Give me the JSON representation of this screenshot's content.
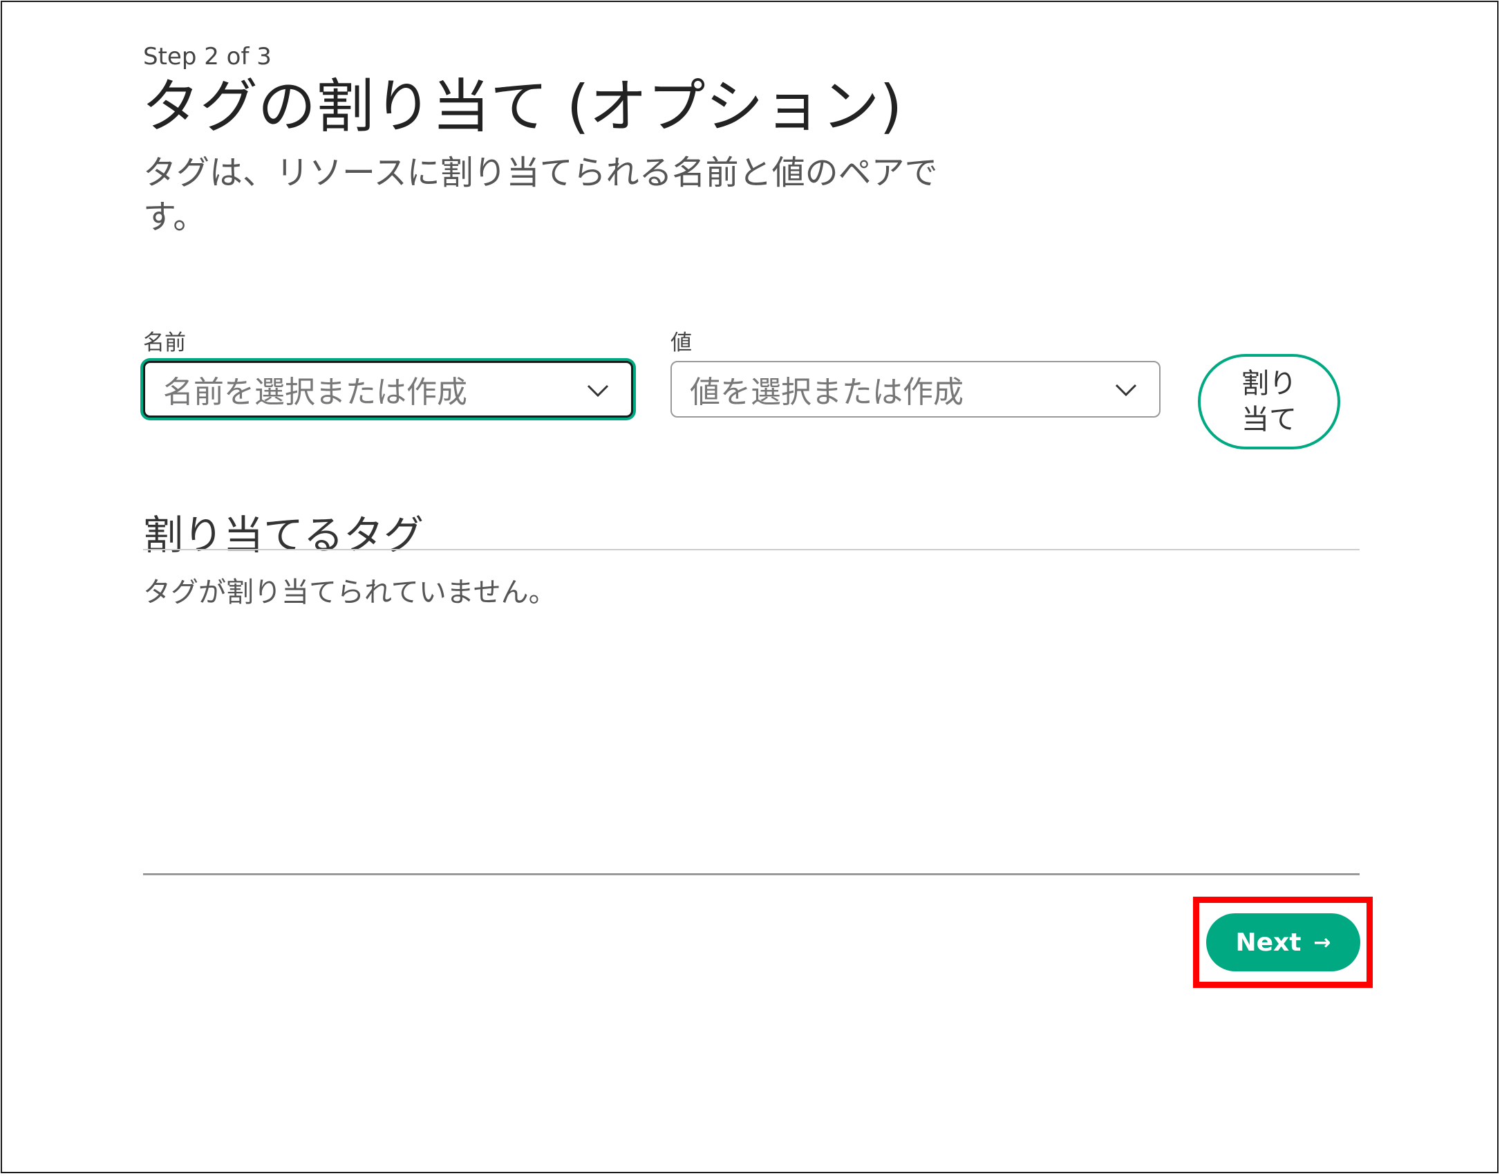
{
  "header": {
    "step": "Step 2 of 3",
    "title": "タグの割り当て (オプション)",
    "description": "タグは、リソースに割り当てられる名前と値のペアです。"
  },
  "form": {
    "name_label": "名前",
    "name_placeholder": "名前を選択または作成",
    "value_label": "値",
    "value_placeholder": "値を選択または作成",
    "assign_label": "割り当て"
  },
  "assigned": {
    "section_title": "割り当てるタグ",
    "empty_message": "タグが割り当てられていません。"
  },
  "footer": {
    "next_label": "Next",
    "next_icon": "arrow-right-icon",
    "highlight_color": "#ff0000"
  },
  "colors": {
    "accent": "#01a982"
  }
}
